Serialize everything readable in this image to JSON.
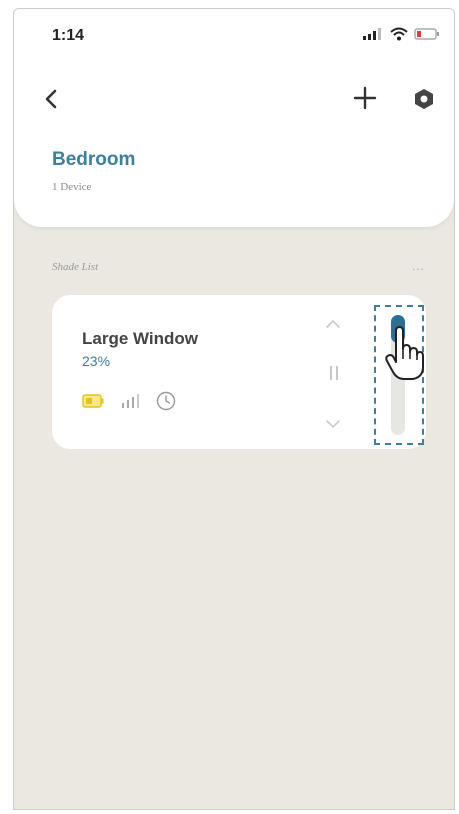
{
  "status_bar": {
    "time": "1:14",
    "icons": [
      "cellular-signal-icon",
      "wifi-icon",
      "battery-low-icon"
    ]
  },
  "nav": {
    "back_icon": "chevron-left-icon",
    "add_icon": "plus-icon",
    "settings_icon": "settings-icon"
  },
  "room": {
    "name": "Bedroom",
    "device_count": "1 Device"
  },
  "shade_list": {
    "label": "Shade List",
    "more": "...",
    "items": [
      {
        "name": "Large Window",
        "position_text": "23%",
        "position_fraction": 0.23,
        "icons": [
          "battery-icon",
          "signal-strength-icon",
          "schedule-clock-icon"
        ],
        "controls": [
          "open-up-icon",
          "pause-icon",
          "close-down-icon"
        ]
      }
    ]
  },
  "colors": {
    "accent": "#3d7fa0",
    "slider_fill": "#2c6f92",
    "battery": "#e6c21a",
    "background": "#ebe7e1"
  }
}
